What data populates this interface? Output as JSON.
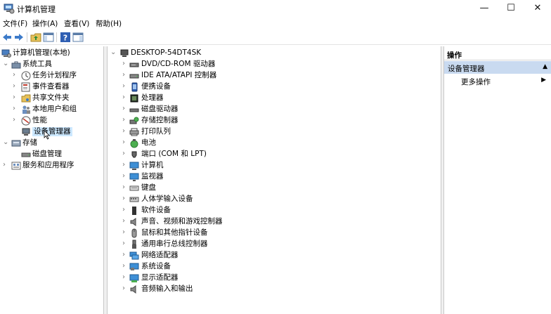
{
  "window": {
    "title": "计算机管理",
    "min": "—",
    "max": "☐",
    "close": "✕"
  },
  "menu": {
    "file": "文件(F)",
    "action": "操作(A)",
    "view": "查看(V)",
    "help": "帮助(H)"
  },
  "tree": {
    "root": "计算机管理(本地)",
    "system_tools": "系统工具",
    "task_scheduler": "任务计划程序",
    "event_viewer": "事件查看器",
    "shared_folders": "共享文件夹",
    "local_users": "本地用户和组",
    "performance": "性能",
    "device_manager": "设备管理器",
    "storage": "存储",
    "disk_management": "磁盘管理",
    "services_apps": "服务和应用程序"
  },
  "devices": {
    "computer_name": "DESKTOP-54DT4SK",
    "items": [
      "DVD/CD-ROM 驱动器",
      "IDE ATA/ATAPI 控制器",
      "便携设备",
      "处理器",
      "磁盘驱动器",
      "存储控制器",
      "打印队列",
      "电池",
      "端口 (COM 和 LPT)",
      "计算机",
      "监视器",
      "键盘",
      "人体学输入设备",
      "软件设备",
      "声音、视频和游戏控制器",
      "鼠标和其他指针设备",
      "通用串行总线控制器",
      "网络适配器",
      "系统设备",
      "显示适配器",
      "音频输入和输出"
    ]
  },
  "actions": {
    "header": "操作",
    "section": "设备管理器",
    "more": "更多操作"
  }
}
